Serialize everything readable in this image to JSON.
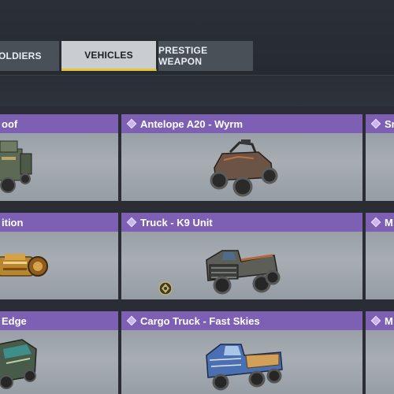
{
  "tabs": {
    "soldiers": "OLDIERS",
    "vehicles": "VEHICLES",
    "prestige": "PRESTIGE WEAPON"
  },
  "colors": {
    "card_header": "#7d5fb3",
    "active_tab_underline": "#e7c23a",
    "active_tab": "#c9cdd2"
  },
  "cards": {
    "r1c1": {
      "name": "oof"
    },
    "r1c2": {
      "name": "Antelope A20 - Wyrm"
    },
    "r1c3": {
      "name": "Sn"
    },
    "r2c1": {
      "name": "ition"
    },
    "r2c2": {
      "name": "Truck - K9 Unit"
    },
    "r2c3": {
      "name": "M"
    },
    "r3c1": {
      "name": "Edge"
    },
    "r3c2": {
      "name": "Cargo Truck - Fast Skies"
    },
    "r3c3": {
      "name": "M"
    }
  }
}
